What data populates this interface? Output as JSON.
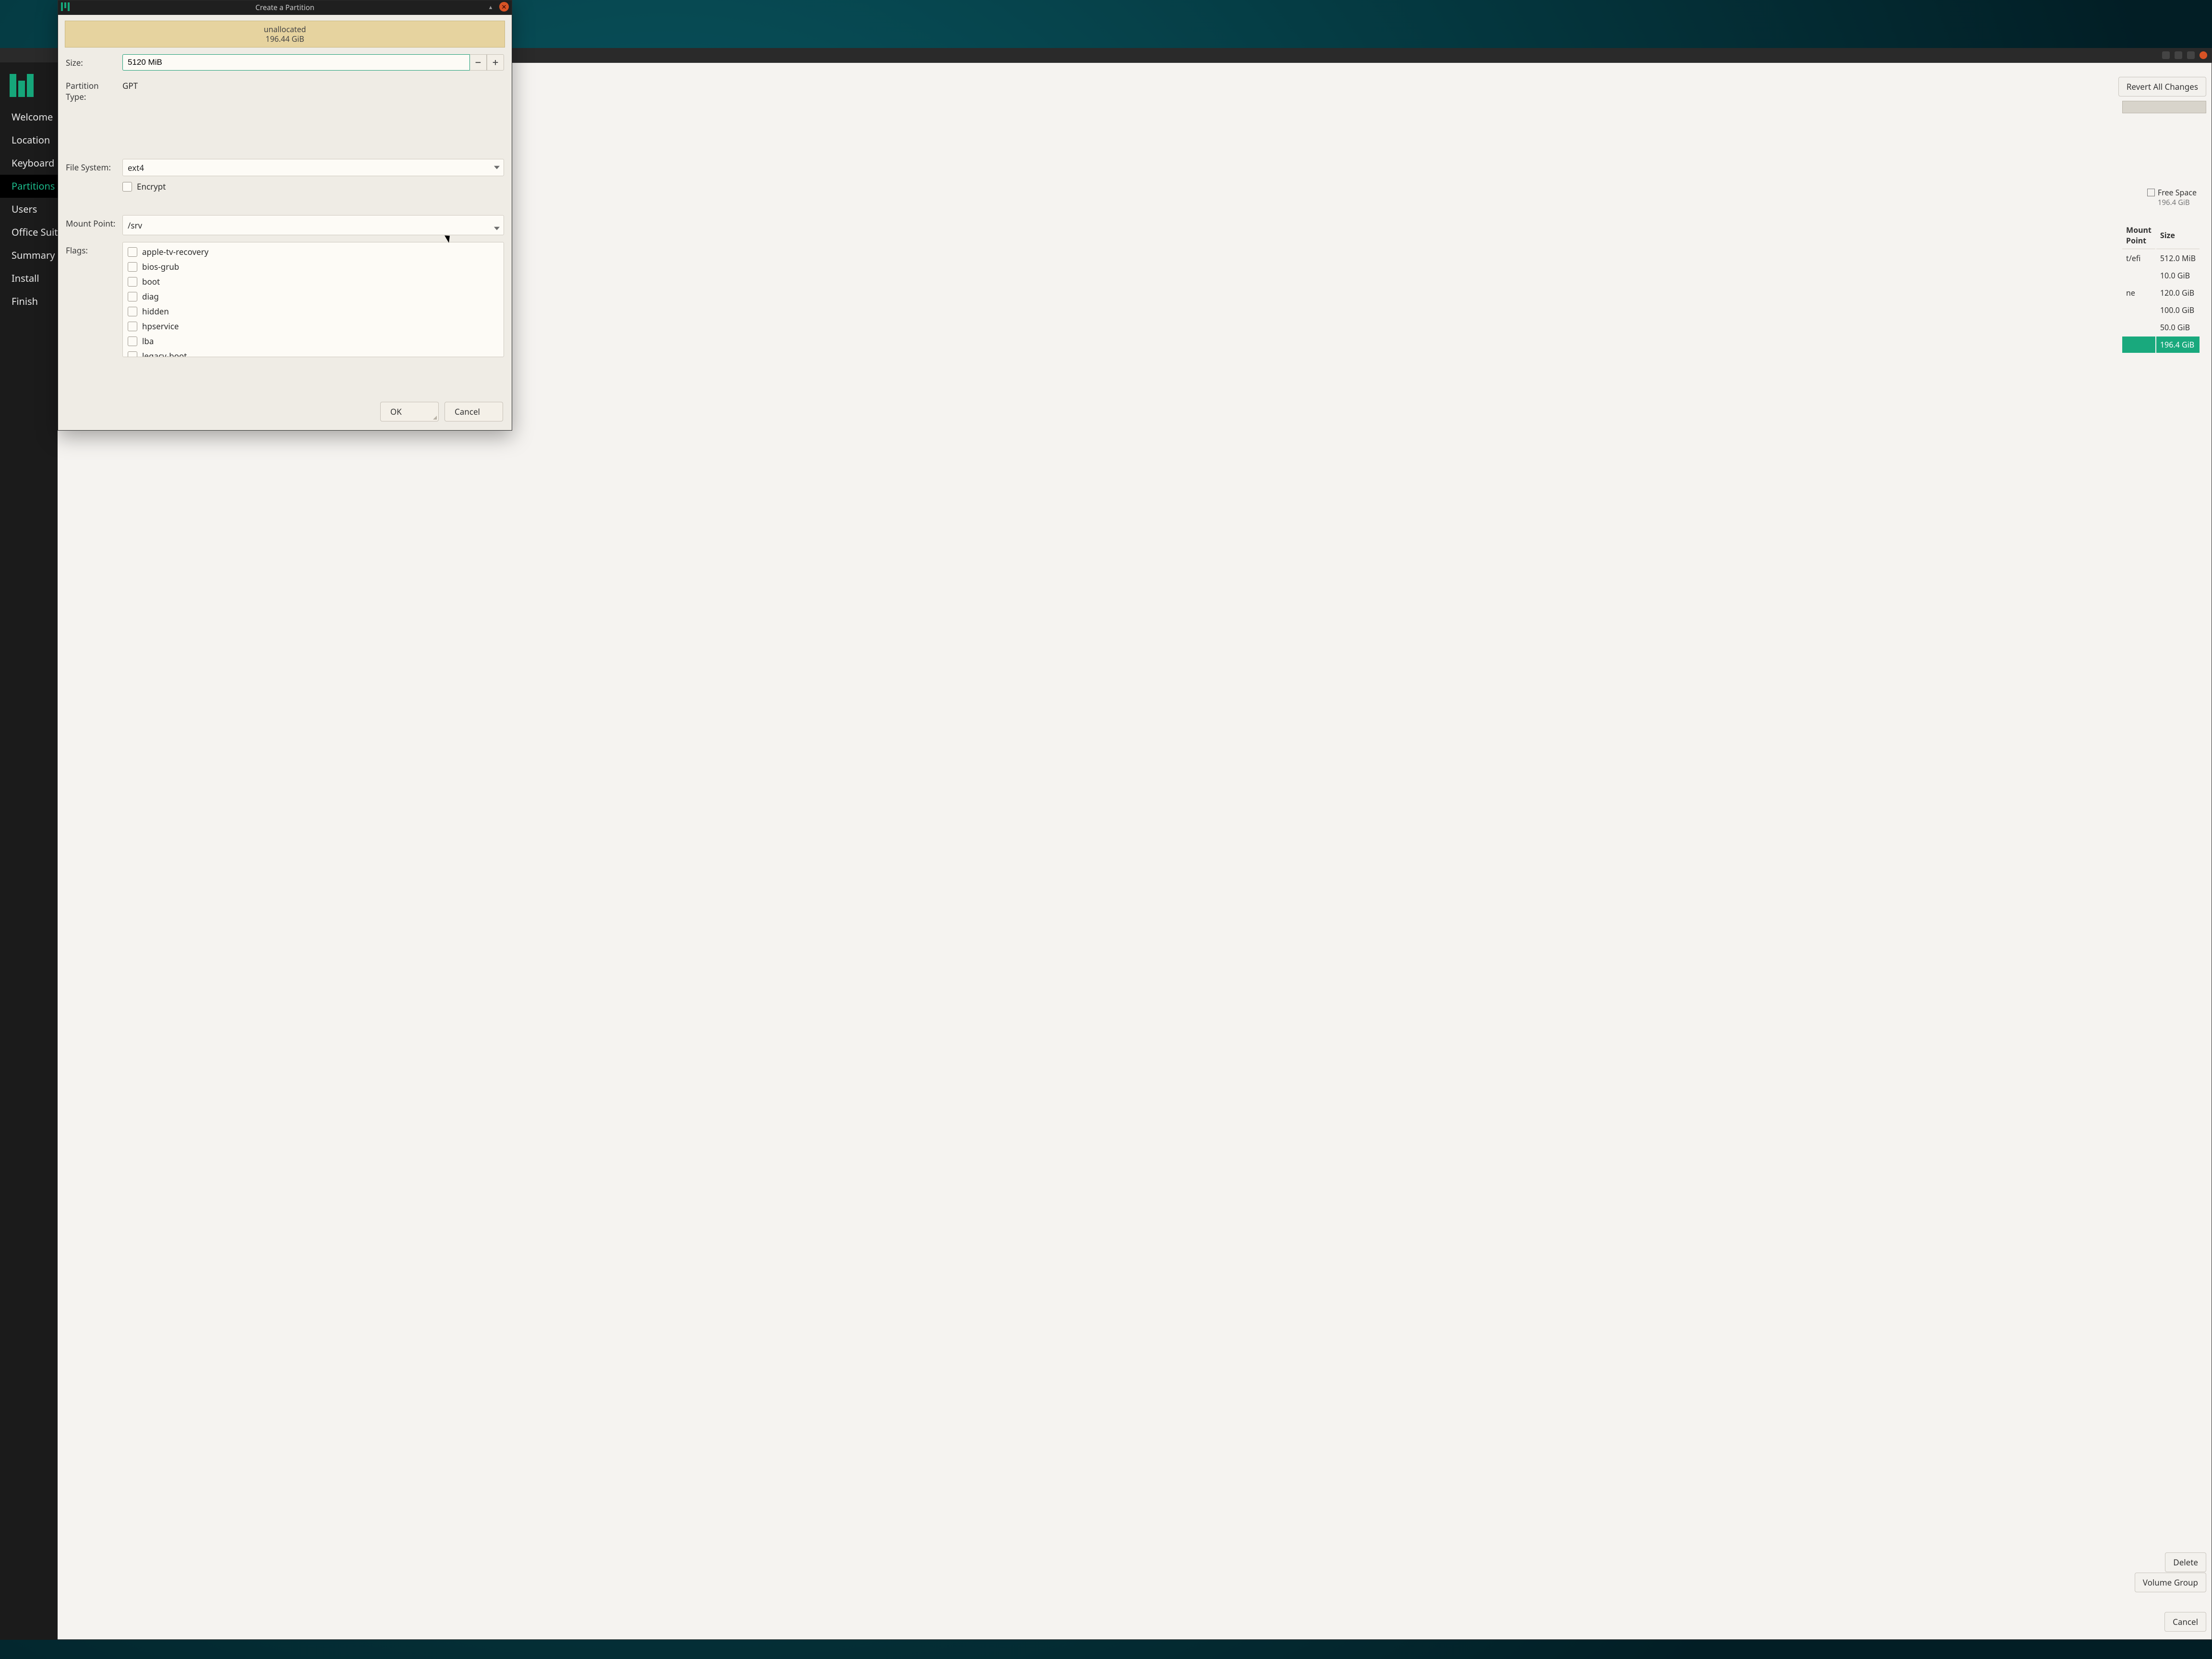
{
  "bg": {
    "titlebar_icons": [
      "up",
      "min",
      "max",
      "close"
    ],
    "sidebar": {
      "items": [
        {
          "label": "Welcome",
          "active": false
        },
        {
          "label": "Location",
          "active": false
        },
        {
          "label": "Keyboard",
          "active": false
        },
        {
          "label": "Partitions",
          "active": true
        },
        {
          "label": "Users",
          "active": false
        },
        {
          "label": "Office Suite",
          "active": false
        },
        {
          "label": "Summary",
          "active": false
        },
        {
          "label": "Install",
          "active": false
        },
        {
          "label": "Finish",
          "active": false
        }
      ]
    },
    "buttons": {
      "revert": "Revert All Changes",
      "delete": "Delete",
      "volume_group": "Volume Group",
      "cancel": "Cancel"
    },
    "legend": {
      "label": "Free Space",
      "sub": "196.4 GiB"
    },
    "table": {
      "headers": {
        "mount": "Mount Point",
        "size": "Size"
      },
      "rows": [
        {
          "mount": "/boot/efi",
          "size": "512.0 MiB",
          "hl": false
        },
        {
          "mount": "",
          "size": "10.0 GiB",
          "hl": false
        },
        {
          "mount": "/home",
          "size": "120.0 GiB",
          "hl": false
        },
        {
          "mount": "",
          "size": "100.0 GiB",
          "hl": false
        },
        {
          "mount": "",
          "size": "50.0 GiB",
          "hl": false
        },
        {
          "mount": "",
          "size": "196.4 GiB",
          "hl": true
        }
      ]
    }
  },
  "dlg": {
    "title": "Create a Partition",
    "disk": {
      "label": "unallocated",
      "size": "196.44 GiB"
    },
    "form": {
      "size_label": "Size:",
      "size_value": "5120",
      "size_unit": "MiB",
      "ptype_label": "Partition Type:",
      "ptype_value": "GPT",
      "fs_label": "File System:",
      "fs_value": "ext4",
      "encrypt_label": "Encrypt",
      "mount_label": "Mount Point:",
      "mount_value": "/srv",
      "flags_label": "Flags:",
      "flags": [
        "apple-tv-recovery",
        "bios-grub",
        "boot",
        "diag",
        "hidden",
        "hpservice",
        "lba",
        "legacy-boot"
      ]
    },
    "footer": {
      "ok": "OK",
      "cancel": "Cancel"
    }
  }
}
